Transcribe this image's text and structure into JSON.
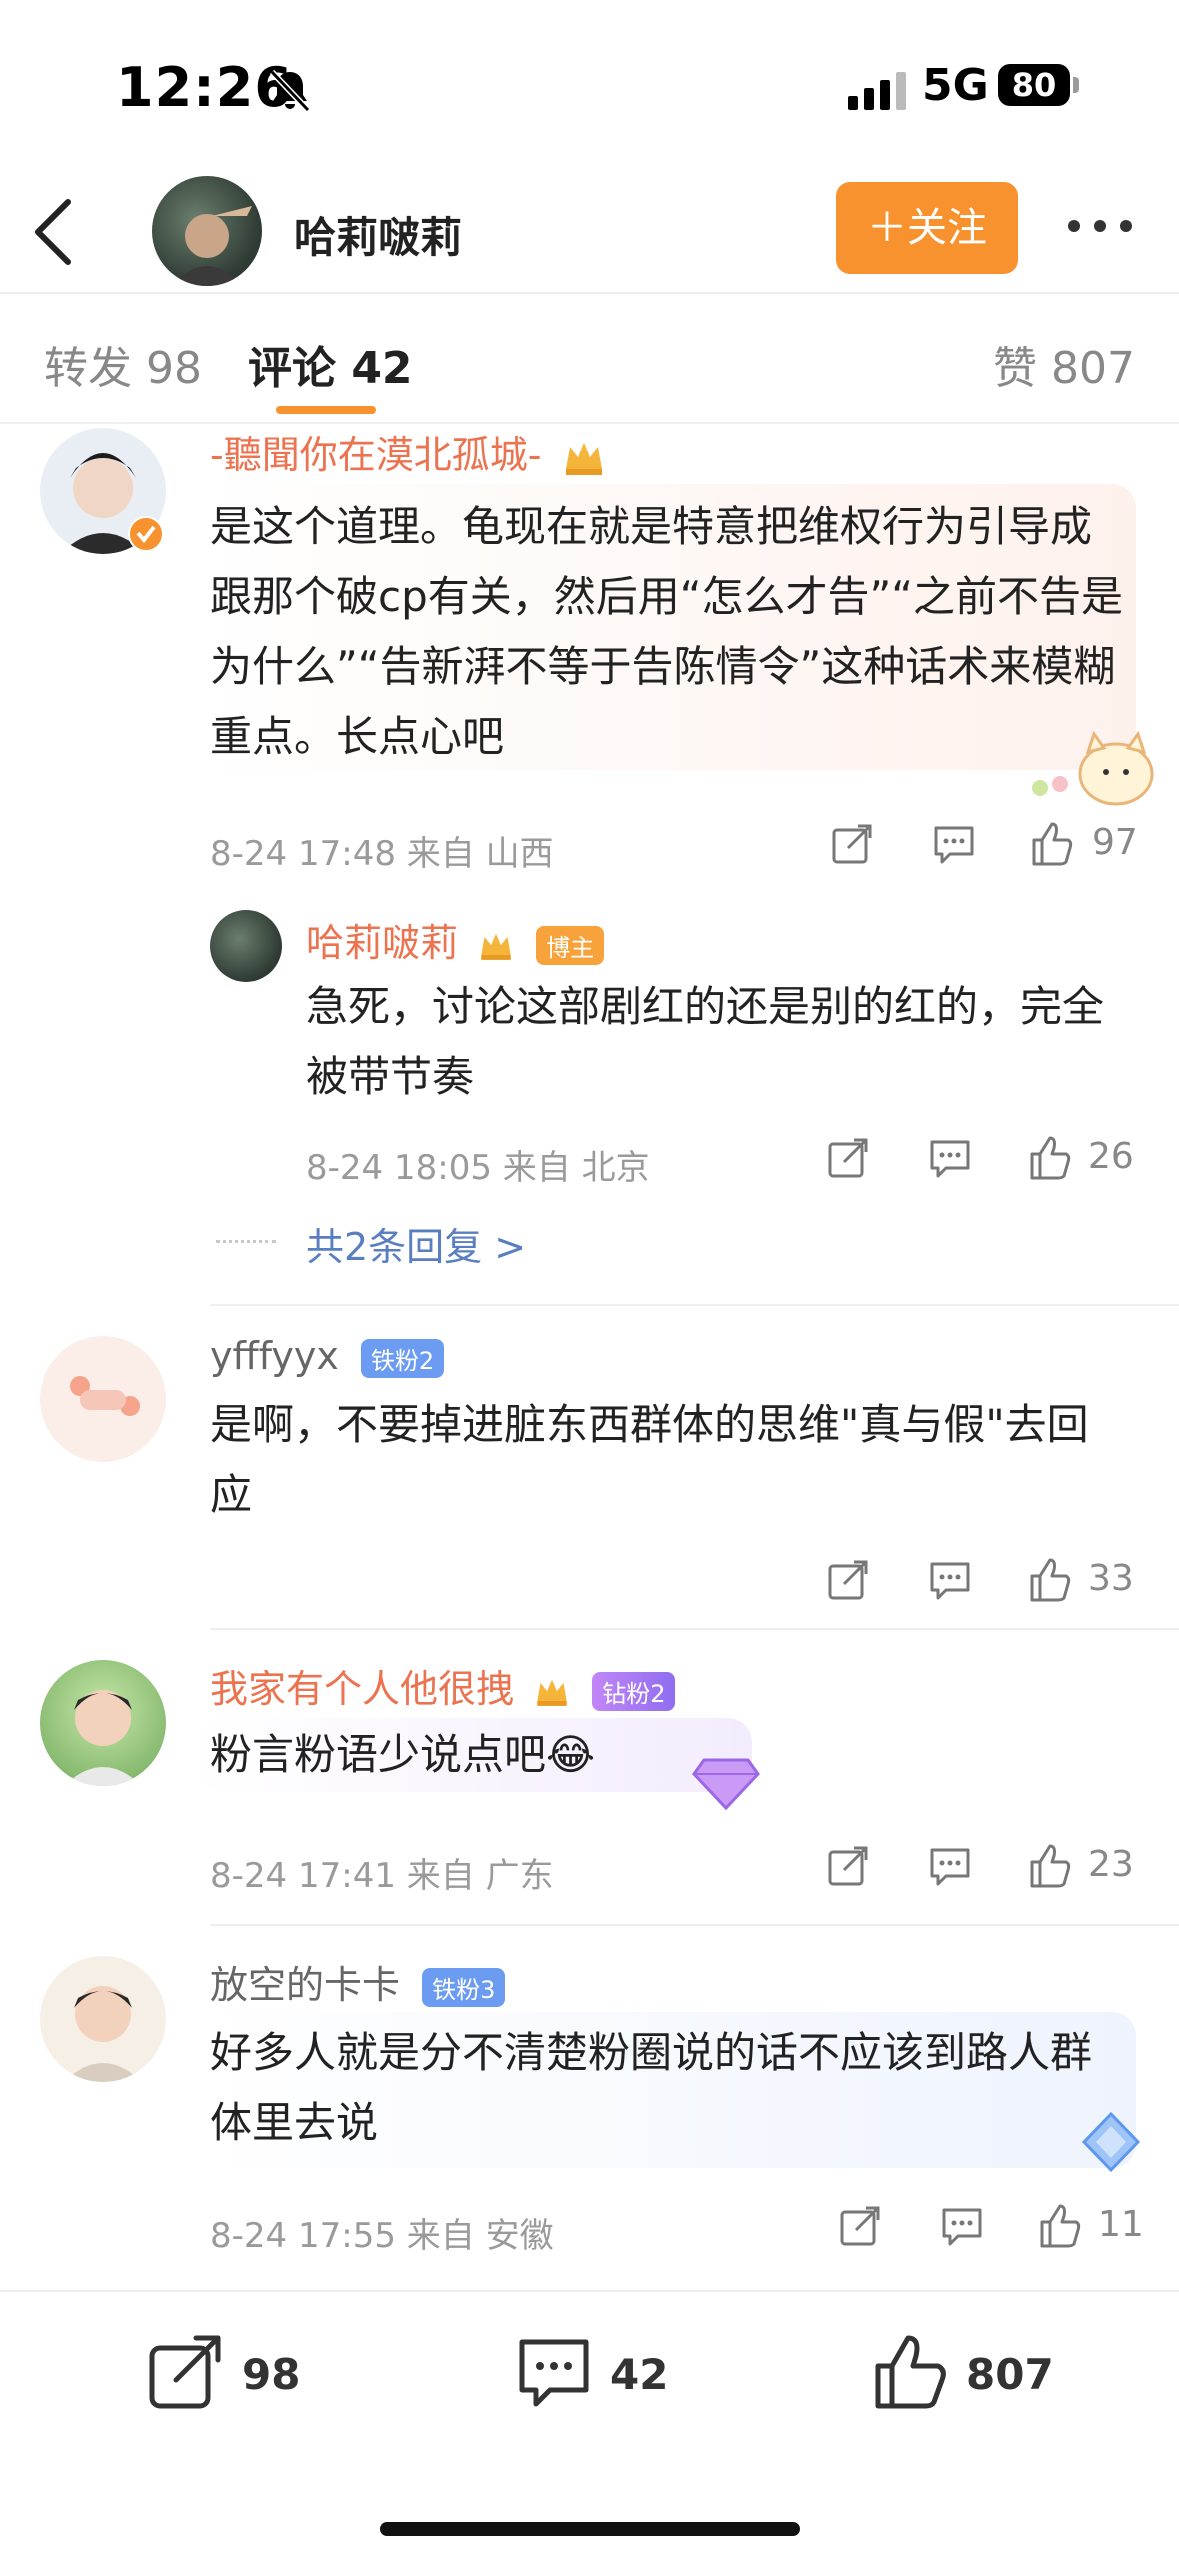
{
  "status_bar": {
    "time": "12:26",
    "network": "5G",
    "battery": "80"
  },
  "header": {
    "name": "哈莉啵莉",
    "follow_label": "＋关注"
  },
  "tabs": {
    "repost": "转发 98",
    "comment": "评论 42",
    "likes": "赞 807"
  },
  "comments": [
    {
      "username": "-聽聞你在漠北孤城-",
      "text": "是这个道理。龟现在就是特意把维权行为引导成跟那个破cp有关，然后用“怎么才告”“之前不告是为什么”“告新湃不等于告陈情令”这种话术来模糊重点。长点心吧",
      "meta": "8-24 17:48  来自 山西",
      "likes": "97",
      "reply": {
        "username": "哈莉啵莉",
        "badge": "博主",
        "text": "急死，讨论这部剧红的还是别的红的，完全被带节奏",
        "meta": "8-24 18:05  来自 北京",
        "likes": "26"
      },
      "more_replies": "共2条回复 >"
    },
    {
      "username": "yfffyyx",
      "badge": "铁粉2",
      "text": "是啊，不要掉进脏东西群体的思维\"真与假\"去回应",
      "likes": "33"
    },
    {
      "username": "我家有个人他很拽",
      "badge": "钻粉2",
      "text": "粉言粉语少说点吧",
      "emoji": "😂",
      "meta": "8-24 17:41  来自 广东",
      "likes": "23"
    },
    {
      "username": "放空的卡卡",
      "badge": "铁粉3",
      "text": "好多人就是分不清楚粉圈说的话不应该到路人群体里去说",
      "meta": "8-24 17:55  来自 安徽",
      "likes": "11"
    }
  ],
  "bottom_bar": {
    "reposts": "98",
    "comments": "42",
    "likes": "807"
  },
  "colors": {
    "accent": "#f7922f",
    "username": "#eb7350",
    "link": "#5a7fc0"
  }
}
